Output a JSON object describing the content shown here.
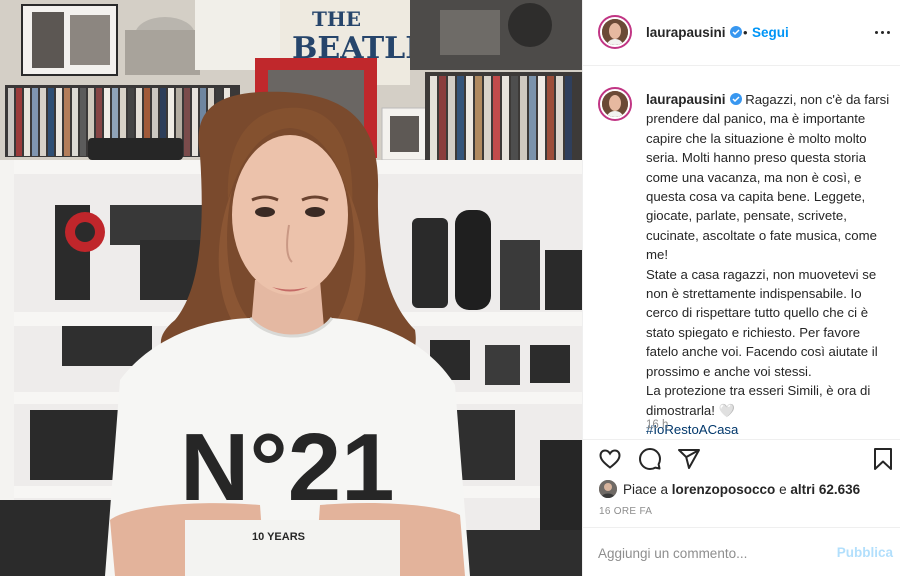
{
  "post": {
    "photo_alt_shirt_text": "N°21",
    "photo_poster_text": "THE BEATLES",
    "photo_shirt_subtext": "10 YEARS"
  },
  "header": {
    "username": "laurapausini",
    "separator": "•",
    "follow_label": "Segui",
    "verified_icon": "verified-badge-icon",
    "more_icon": "more-options-icon"
  },
  "caption": {
    "username": "laurapausini",
    "paragraph1": "Ragazzi, non c'è da farsi prendere dal panico, ma è importante capire che la situazione è molto molto seria. Molti hanno preso questa storia come una vacanza, ma non è così, e questa cosa va capita bene. Leggete, giocate, parlate, pensate, scrivete, cucinate, ascoltate o fate musica, come me!",
    "paragraph2": "State a casa ragazzi, non muovetevi se non è strettamente indispensabile. Io cerco di rispettare tutto quello che ci è stato spiegato e richiesto. Per favore fatelo anche voi. Facendo così aiutate il prossimo e anche voi stessi.",
    "paragraph3": "La protezione tra esseri Simili, è ora di dimostrarla! 🤍",
    "hashtag": "#IoRestoACasa",
    "time": "16 h"
  },
  "actions": {
    "like_icon": "heart-icon",
    "comment_icon": "comment-bubble-icon",
    "share_icon": "paper-plane-icon",
    "save_icon": "bookmark-icon"
  },
  "likes": {
    "prefix": "Piace a",
    "user": "lorenzoposocco",
    "connector": "e",
    "others": "altri 62.636"
  },
  "timestamp": "16 ORE FA",
  "comment": {
    "placeholder": "Aggiungi un commento...",
    "publish_label": "Pubblica"
  },
  "colors": {
    "accent_blue": "#0095f6",
    "verified_blue": "#3897f0",
    "hashtag_blue": "#00376b",
    "publish_disabled": "#b2dffc",
    "muted_gray": "#8e8e8e"
  }
}
